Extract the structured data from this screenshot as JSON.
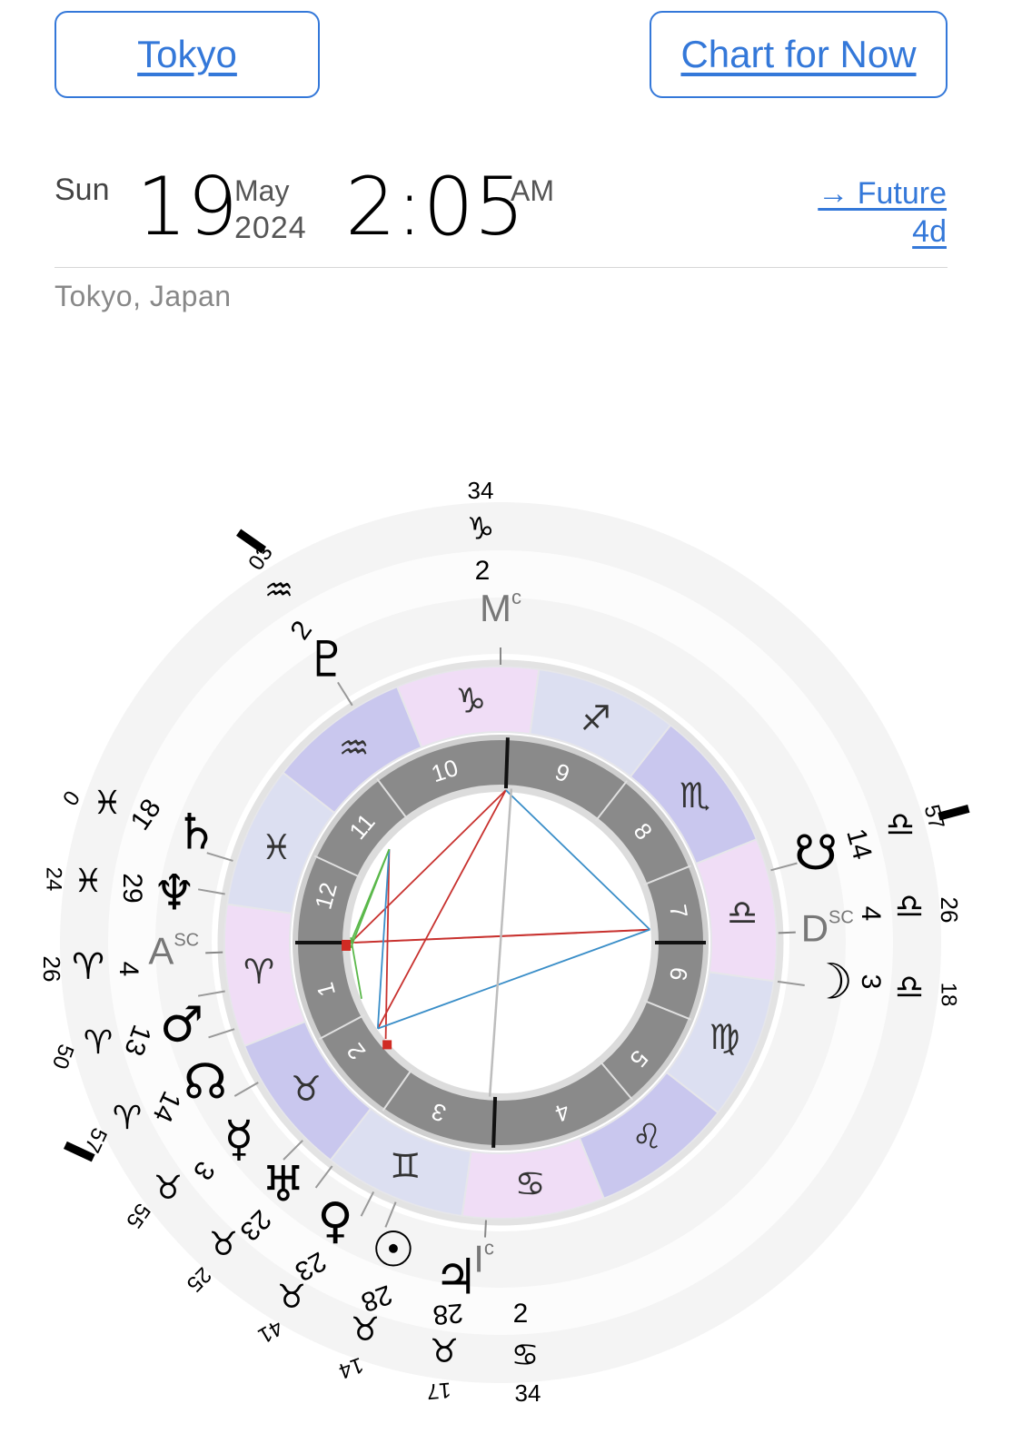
{
  "header": {
    "city_button": "Tokyo",
    "now_button": "Chart for Now"
  },
  "datetime": {
    "weekday": "Sun",
    "day": "19",
    "month": "May",
    "year": "2024",
    "time": "2:05",
    "ampm": "AM",
    "future_line1": "→ Future",
    "future_line2": "4d"
  },
  "location": "Tokyo, Japan",
  "chart": {
    "colors": {
      "pink_sign": "#f0ddf6",
      "blue_sign": "#dcdff1",
      "purple_sign": "#c9c7ee",
      "house_ring": "#8a8a8a",
      "outer_bands": "#f4f4f4",
      "aspect_red": "#c8322f",
      "aspect_blue": "#3a8ec8",
      "aspect_green": "#5ab84a"
    },
    "signs": [
      {
        "name": "aries",
        "glyph": "♈︎",
        "fill": "pink"
      },
      {
        "name": "taurus",
        "glyph": "♉︎",
        "fill": "purple"
      },
      {
        "name": "gemini",
        "glyph": "♊︎",
        "fill": "blue"
      },
      {
        "name": "cancer",
        "glyph": "♋︎",
        "fill": "pink"
      },
      {
        "name": "leo",
        "glyph": "♌︎",
        "fill": "purple"
      },
      {
        "name": "virgo",
        "glyph": "♍︎",
        "fill": "blue"
      },
      {
        "name": "libra",
        "glyph": "♎︎",
        "fill": "pink"
      },
      {
        "name": "scorpio",
        "glyph": "♏︎",
        "fill": "purple"
      },
      {
        "name": "sagittarius",
        "glyph": "♐︎",
        "fill": "blue"
      },
      {
        "name": "capricorn",
        "glyph": "♑︎",
        "fill": "pink"
      },
      {
        "name": "aquarius",
        "glyph": "♒︎",
        "fill": "purple"
      },
      {
        "name": "pisces",
        "glyph": "♓︎",
        "fill": "blue"
      }
    ],
    "houses": [
      "1",
      "2",
      "3",
      "4",
      "5",
      "6",
      "7",
      "8",
      "9",
      "10",
      "11",
      "12"
    ],
    "angles": [
      {
        "name": "mc",
        "label": "M",
        "sup": "c",
        "deg": "2",
        "sign": "♑︎",
        "min": "34"
      },
      {
        "name": "ic",
        "label": "I",
        "sup": "c",
        "deg": "2",
        "sign": "♋︎",
        "min": "34"
      },
      {
        "name": "asc",
        "label": "A",
        "sup": "SC",
        "deg": "4",
        "sign": "♈︎",
        "min": "26"
      },
      {
        "name": "dsc",
        "label": "D",
        "sup": "SC",
        "deg": "4",
        "sign": "♎︎",
        "min": "26"
      }
    ],
    "bodies": [
      {
        "name": "pluto",
        "glyph": "♇",
        "deg": "2",
        "sign": "♒︎",
        "min": "03",
        "retro_mark": true
      },
      {
        "name": "saturn",
        "glyph": "♄",
        "deg": "18",
        "sign": "♓︎",
        "min": "0"
      },
      {
        "name": "neptune",
        "glyph": "♆",
        "deg": "29",
        "sign": "♓︎",
        "min": "24"
      },
      {
        "name": "mars",
        "glyph": "♂",
        "deg": "13",
        "sign": "♈︎",
        "min": "50"
      },
      {
        "name": "north-node",
        "glyph": "☊",
        "deg": "14",
        "sign": "♈︎",
        "min": "57",
        "retro_mark": true
      },
      {
        "name": "mercury",
        "glyph": "☿",
        "deg": "3",
        "sign": "♉︎",
        "min": "55"
      },
      {
        "name": "uranus",
        "glyph": "♅",
        "deg": "23",
        "sign": "♉︎",
        "min": "25"
      },
      {
        "name": "venus",
        "glyph": "♀",
        "deg": "23",
        "sign": "♉︎",
        "min": "41"
      },
      {
        "name": "sun",
        "glyph": "☉",
        "deg": "28",
        "sign": "♉︎",
        "min": "14"
      },
      {
        "name": "jupiter",
        "glyph": "♃",
        "deg": "28",
        "sign": "♉︎",
        "min": "17"
      },
      {
        "name": "south-node",
        "glyph": "☋",
        "deg": "14",
        "sign": "♎︎",
        "min": "57",
        "retro_mark": true
      },
      {
        "name": "moon",
        "glyph": "☽",
        "deg": "3",
        "sign": "♎︎",
        "min": "18"
      }
    ]
  }
}
